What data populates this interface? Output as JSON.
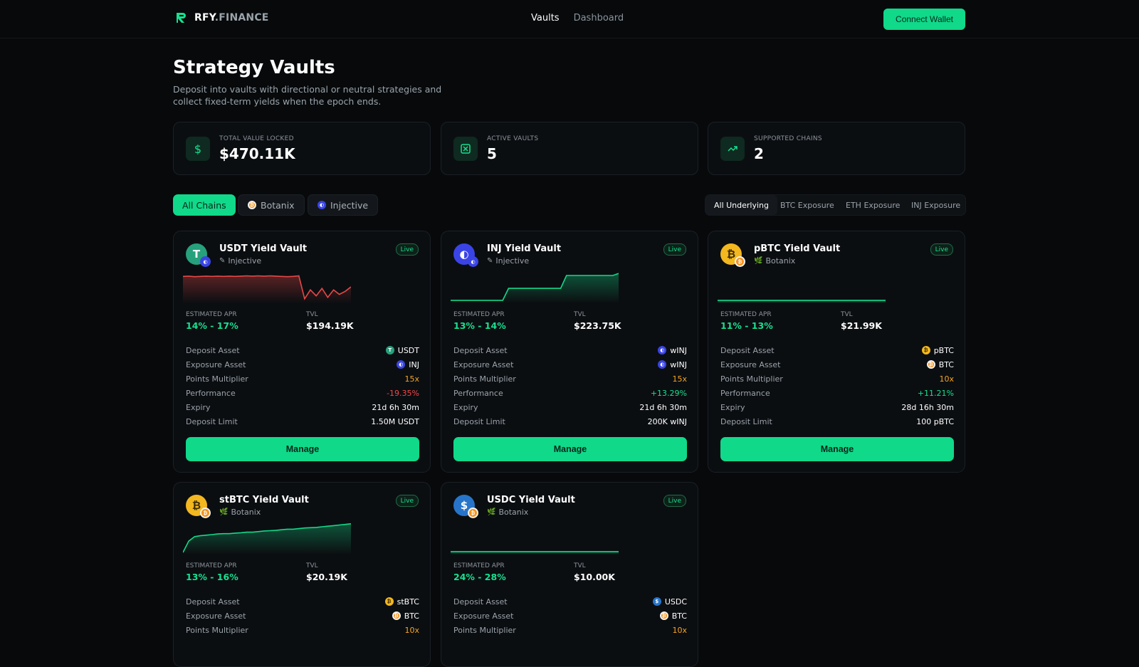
{
  "brand": {
    "name_a": "RFY",
    "name_b": ".FINANCE"
  },
  "nav": {
    "vaults": "Vaults",
    "dashboard": "Dashboard"
  },
  "connect_label": "Connect Wallet",
  "page": {
    "title": "Strategy Vaults",
    "subtitle": "Deposit into vaults with directional or neutral strategies and collect fixed-term yields when the epoch ends."
  },
  "stats": [
    {
      "label": "TOTAL VALUE LOCKED",
      "value": "$470.11K",
      "icon": "dollar-icon"
    },
    {
      "label": "ACTIVE VAULTS",
      "value": "5",
      "icon": "vault-icon"
    },
    {
      "label": "SUPPORTED CHAINS",
      "value": "2",
      "icon": "trending-up-icon"
    }
  ],
  "chain_filters": [
    {
      "label": "All Chains",
      "active": true
    },
    {
      "label": "Botanix",
      "active": false,
      "icon": "btc-icon"
    },
    {
      "label": "Injective",
      "active": false,
      "icon": "injective-icon"
    }
  ],
  "underlying_filters": [
    {
      "label": "All Underlying",
      "active": true
    },
    {
      "label": "BTC Exposure",
      "active": false
    },
    {
      "label": "ETH Exposure",
      "active": false
    },
    {
      "label": "INJ Exposure",
      "active": false
    }
  ],
  "row_labels": {
    "deposit_asset": "Deposit Asset",
    "exposure_asset": "Exposure Asset",
    "points_multiplier": "Points Multiplier",
    "performance": "Performance",
    "expiry": "Expiry",
    "deposit_limit": "Deposit Limit",
    "apr": "ESTIMATED APR",
    "tvl": "TVL",
    "manage": "Manage",
    "live": "Live"
  },
  "vaults": [
    {
      "name": "USDT Yield Vault",
      "chain": "Injective",
      "apr": "14% - 17%",
      "tvl": "$194.19K",
      "deposit_asset": "USDT",
      "exposure_asset": "INJ",
      "points": "15x",
      "performance": "-19.35%",
      "performance_trend": "negative",
      "expiry": "21d 6h 30m",
      "limit": "1.50M USDT",
      "spark_color": "#e54848",
      "spark": [
        0.15,
        0.14,
        0.16,
        0.15,
        0.14,
        0.15,
        0.14,
        0.15,
        0.14,
        0.15,
        0.14,
        0.13,
        0.14,
        0.13,
        0.14,
        0.13,
        0.14,
        0.15,
        0.16,
        0.15,
        0.13,
        0.9,
        0.6,
        0.8,
        0.55,
        0.85,
        0.6,
        0.75,
        0.65,
        0.5
      ]
    },
    {
      "name": "INJ Yield Vault",
      "chain": "Injective",
      "apr": "13% - 14%",
      "tvl": "$223.75K",
      "deposit_asset": "wINJ",
      "exposure_asset": "wINJ",
      "points": "15x",
      "performance": "+13.29%",
      "performance_trend": "positive",
      "expiry": "21d 6h 30m",
      "limit": "200K wINJ",
      "spark_color": "#14d889",
      "spark": [
        0.95,
        0.95,
        0.95,
        0.95,
        0.95,
        0.95,
        0.95,
        0.95,
        0.95,
        0.95,
        0.55,
        0.55,
        0.55,
        0.55,
        0.55,
        0.55,
        0.55,
        0.55,
        0.55,
        0.55,
        0.12,
        0.12,
        0.12,
        0.12,
        0.12,
        0.12,
        0.12,
        0.12,
        0.12,
        0.05
      ]
    },
    {
      "name": "pBTC Yield Vault",
      "chain": "Botanix",
      "apr": "11% - 13%",
      "tvl": "$21.99K",
      "deposit_asset": "pBTC",
      "exposure_asset": "BTC",
      "points": "10x",
      "performance": "+11.21%",
      "performance_trend": "positive",
      "expiry": "28d 16h 30m",
      "limit": "100 pBTC",
      "spark_color": "#14d889",
      "spark": [
        0.95,
        0.95,
        0.95,
        0.95,
        0.95,
        0.95,
        0.95,
        0.95,
        0.95,
        0.95,
        0.95,
        0.95,
        0.95,
        0.95,
        0.95,
        0.95,
        0.95,
        0.95,
        0.95,
        0.95,
        0.95,
        0.95,
        0.95,
        0.95,
        0.95,
        0.95,
        0.95,
        0.95,
        0.95,
        0.95
      ]
    },
    {
      "name": "stBTC Yield Vault",
      "chain": "Botanix",
      "apr": "13% - 16%",
      "tvl": "$20.19K",
      "deposit_asset": "stBTC",
      "exposure_asset": "BTC",
      "points": "10x",
      "spark_color": "#14d889",
      "spark": [
        0.98,
        0.6,
        0.45,
        0.42,
        0.4,
        0.38,
        0.36,
        0.35,
        0.35,
        0.33,
        0.32,
        0.3,
        0.3,
        0.28,
        0.26,
        0.25,
        0.24,
        0.22,
        0.2,
        0.2,
        0.18,
        0.16,
        0.15,
        0.14,
        0.12,
        0.1,
        0.08,
        0.06,
        0.04,
        0.02
      ]
    },
    {
      "name": "USDC Yield Vault",
      "chain": "Botanix",
      "apr": "24% - 28%",
      "tvl": "$10.00K",
      "deposit_asset": "USDC",
      "exposure_asset": "BTC",
      "points": "10x",
      "spark_color": "#14d889",
      "spark": [
        0.95,
        0.95,
        0.95,
        0.95,
        0.95,
        0.95,
        0.95,
        0.95,
        0.95,
        0.95,
        0.95,
        0.95,
        0.95,
        0.95,
        0.95,
        0.95,
        0.95,
        0.95,
        0.95,
        0.95,
        0.95,
        0.95,
        0.95,
        0.95,
        0.95,
        0.95,
        0.95,
        0.95,
        0.95,
        0.95
      ]
    }
  ]
}
